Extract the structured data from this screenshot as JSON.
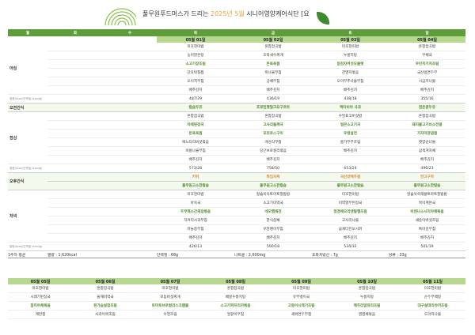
{
  "header": {
    "title_pre": "풀무원푸드머스가 드리는 ",
    "title_month": "2025년 5월",
    "title_post": " 시니어영양케어식단 [요"
  },
  "days": [
    "월",
    "화",
    "수",
    "목",
    "금",
    "토",
    "일"
  ],
  "week1": {
    "dates": [
      "",
      "",
      "",
      "05월 01일",
      "05월 02일",
      "05월 03일",
      "05월 04일"
    ],
    "breakfast": {
      "label": "아침",
      "rows": [
        [
          "",
          "",
          "",
          "미호현미밥",
          "혼합잡곡밥",
          "미호현미밥",
          "혼합잡곡밥"
        ],
        [
          "",
          "",
          "",
          "농어맑은탕",
          "호박새우찌개",
          "누룽지탕",
          "무채국"
        ],
        [
          "",
          "",
          "",
          "소고기장조림",
          "돈육육찜",
          "알감자버섯오물렛",
          "우민치기치조림"
        ],
        [
          "",
          "",
          "",
          "단호박찰찜",
          "취나물무침",
          "잔멸치볶음",
          "국산콩연두부"
        ],
        [
          "",
          "",
          "",
          "오이지무침",
          "공채무침",
          "오이부추나물무침",
          "시금치나물"
        ],
        [
          "",
          "",
          "",
          "배추김치",
          "배추김치",
          "배추김치",
          "배추김치"
        ]
      ],
      "highlight_row": 2,
      "nutrition_label": "열량(kcal)/단백질 (kcal/g)",
      "nutrition": [
        "",
        "",
        "",
        "487/29",
        "436/19",
        "438/18",
        "355/16"
      ]
    },
    "morning_snack": {
      "label": "오전간식",
      "items": [
        "",
        "",
        "",
        "칼슘두유",
        "프로틴팻밀크요구르트",
        "액티비아 사과",
        "검은콩두유"
      ]
    },
    "lunch": {
      "label": "점심",
      "rows": [
        [
          "",
          "",
          "",
          "혼합잡곡밥",
          "혼합잡곡밥",
          "우엉표고버섯밥",
          "혼합잡곡밥"
        ],
        [
          "",
          "",
          "",
          "야채된장국",
          "고사리들깨국",
          "얼큰소고기국",
          "돼지불고기비소전골"
        ],
        [
          "",
          "",
          "",
          "돈육육찜",
          "오리로스구이",
          "우렁살전",
          "가자미양념찜"
        ],
        [
          "",
          "",
          "",
          "애느타리버섯볶음",
          "개성식무찜",
          "롱가부무조림",
          "햇양순나물"
        ],
        [
          "",
          "",
          "",
          "비름나물무침",
          "당근브로컬리볶음",
          "배추김치",
          "삼색겨자채"
        ],
        [
          "",
          "",
          "",
          "배추김치",
          "배추김치",
          "",
          "배추김치"
        ]
      ],
      "highlight_rows": [
        1,
        2
      ],
      "nutrition": [
        "",
        "",
        "",
        "573/28",
        "758/50",
        "653/24",
        "496/23"
      ]
    },
    "afternoon_snack": {
      "label": "오후간식",
      "items1": [
        "",
        "",
        "",
        "키위",
        "흑임자죽",
        "국산양배추찜",
        "한고구마"
      ],
      "items2": [
        "",
        "",
        "",
        "풀무원고소한칼슘",
        "풀무원고소한칼슘",
        "풀무원고소한칼슘",
        "풀무원고소한칼슘"
      ]
    },
    "dinner": {
      "label": "저녁",
      "rows": [
        [
          "",
          "",
          "",
          "미호현미밥",
          "칼슘쑥쑥토마토찰밥밥",
          "미호현미밥",
          "칼슘쑥쑥해물토마토찰밥밥"
        ],
        [
          "",
          "",
          "",
          "아욱국",
          "소고기미역국",
          "미역열무된장국",
          "목이계란국"
        ],
        [
          "",
          "",
          "",
          "두부해소간찌장볶음",
          "네모햄채전",
          "청경채오리엔탈햄조림",
          "비엔나소시지야채볶음"
        ],
        [
          "",
          "",
          "",
          "치커리사과무침",
          "한식잡채",
          "고사리나물",
          "새송이버섯조림"
        ],
        [
          "",
          "",
          "",
          "마늘쫑무침",
          "우엉땡이무침",
          "곱게다진보시피",
          "톡미김무침"
        ],
        [
          "",
          "",
          "",
          "배추김치",
          "배추김치",
          "배추김치",
          "배추김치"
        ]
      ],
      "highlight_row": 2,
      "nutrition": [
        "",
        "",
        "",
        "426/13",
        "500/18",
        "534/32",
        "501/19"
      ]
    }
  },
  "average": {
    "label": "1주차 평균",
    "kcal": "열량 : 1,620kcal",
    "protein": "단백질 : 68g",
    "sodium": "나트륨 : 2,600mg",
    "fiber": "포화지방산 : 7g",
    "sugar": "당류 : 33g"
  },
  "week2": {
    "dates": [
      "05월 05일",
      "05월 06일",
      "05월 07일",
      "05월 08일",
      "05월 09일",
      "05월 10일",
      "05월 11일"
    ],
    "breakfast": {
      "label": "아침",
      "rows": [
        [
          "미호현미밥",
          "혼합잡곡밥",
          "미호현미밥",
          "혼합잡곡밥",
          "미호현미밥",
          "혼합잡곡밥",
          "미호현미밥"
        ],
        [
          "시래기된장국",
          "들깨미역국",
          "모듬버섯찌개",
          "배뭉누룽지탕",
          "유부뱅이국",
          "누룽지탕",
          "순두부백탕"
        ],
        [
          "참치야채볶음",
          "된가슴살찹조림",
          "토마토브로컬리스크램블",
          "소고기파프리카볶음",
          "고등어시래기조림",
          "메추리알꽈리조림",
          "대구살데리야끼조림"
        ],
        [
          "계란찜",
          "사각어묵조림",
          "우엉조림",
          "얼갈이무침",
          "새싹연두부찜",
          "앰엽채볶음",
          "도라지나물"
        ]
      ],
      "highlight_row": 2
    }
  }
}
